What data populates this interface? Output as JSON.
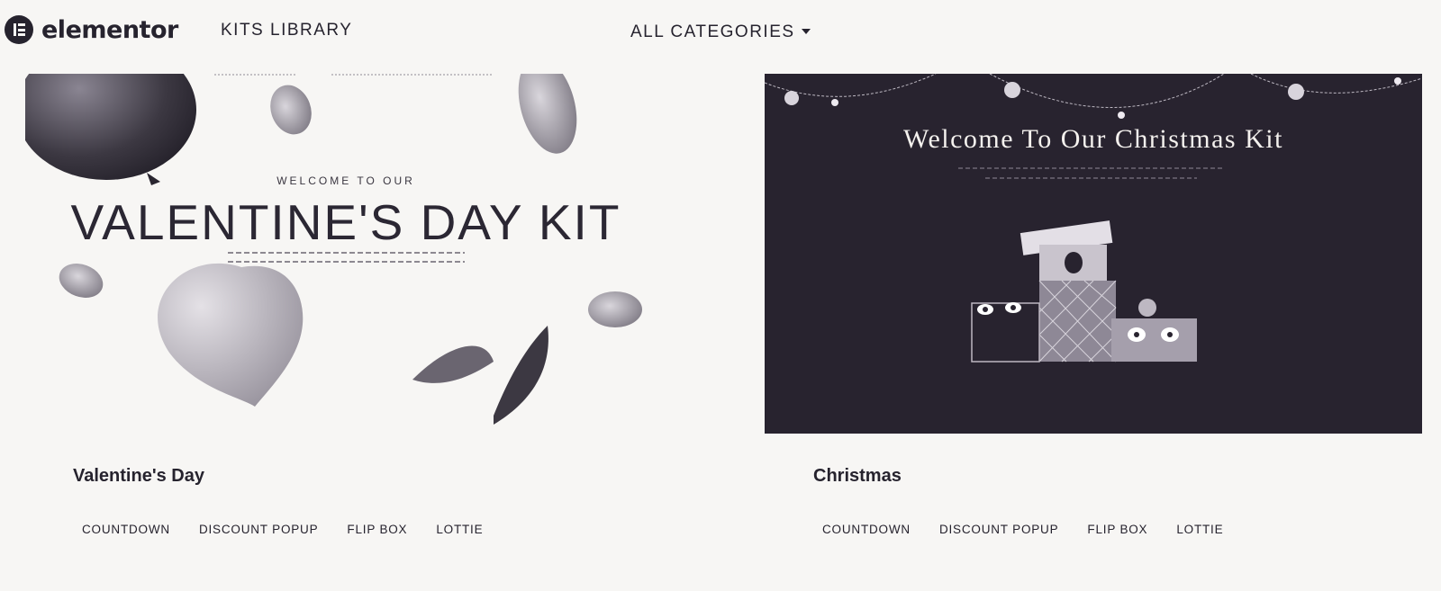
{
  "header": {
    "logo_text": "elementor",
    "kits_library": "KITS LIBRARY",
    "categories_dropdown": "ALL CATEGORIES"
  },
  "kits": [
    {
      "title": "Valentine's Day",
      "thumbnail": {
        "eyebrow": "WELCOME TO OUR",
        "headline": "VALENTINE'S DAY KIT"
      },
      "tags": [
        "COUNTDOWN",
        "DISCOUNT POPUP",
        "FLIP BOX",
        "LOTTIE"
      ]
    },
    {
      "title": "Christmas",
      "thumbnail": {
        "headline": "Welcome To Our Christmas Kit"
      },
      "tags": [
        "COUNTDOWN",
        "DISCOUNT POPUP",
        "FLIP BOX",
        "LOTTIE"
      ]
    }
  ],
  "colors": {
    "background": "#f7f6f4",
    "text": "#26232e",
    "christmas_bg": "#28232f"
  }
}
